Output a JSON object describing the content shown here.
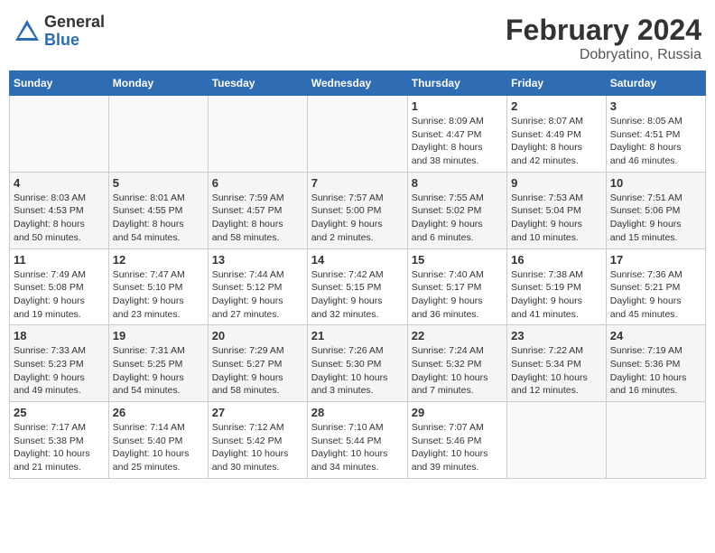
{
  "header": {
    "logo_general": "General",
    "logo_blue": "Blue",
    "month": "February 2024",
    "location": "Dobryatino, Russia"
  },
  "days_of_week": [
    "Sunday",
    "Monday",
    "Tuesday",
    "Wednesday",
    "Thursday",
    "Friday",
    "Saturday"
  ],
  "weeks": [
    [
      {
        "day": "",
        "info": ""
      },
      {
        "day": "",
        "info": ""
      },
      {
        "day": "",
        "info": ""
      },
      {
        "day": "",
        "info": ""
      },
      {
        "day": "1",
        "info": "Sunrise: 8:09 AM\nSunset: 4:47 PM\nDaylight: 8 hours\nand 38 minutes."
      },
      {
        "day": "2",
        "info": "Sunrise: 8:07 AM\nSunset: 4:49 PM\nDaylight: 8 hours\nand 42 minutes."
      },
      {
        "day": "3",
        "info": "Sunrise: 8:05 AM\nSunset: 4:51 PM\nDaylight: 8 hours\nand 46 minutes."
      }
    ],
    [
      {
        "day": "4",
        "info": "Sunrise: 8:03 AM\nSunset: 4:53 PM\nDaylight: 8 hours\nand 50 minutes."
      },
      {
        "day": "5",
        "info": "Sunrise: 8:01 AM\nSunset: 4:55 PM\nDaylight: 8 hours\nand 54 minutes."
      },
      {
        "day": "6",
        "info": "Sunrise: 7:59 AM\nSunset: 4:57 PM\nDaylight: 8 hours\nand 58 minutes."
      },
      {
        "day": "7",
        "info": "Sunrise: 7:57 AM\nSunset: 5:00 PM\nDaylight: 9 hours\nand 2 minutes."
      },
      {
        "day": "8",
        "info": "Sunrise: 7:55 AM\nSunset: 5:02 PM\nDaylight: 9 hours\nand 6 minutes."
      },
      {
        "day": "9",
        "info": "Sunrise: 7:53 AM\nSunset: 5:04 PM\nDaylight: 9 hours\nand 10 minutes."
      },
      {
        "day": "10",
        "info": "Sunrise: 7:51 AM\nSunset: 5:06 PM\nDaylight: 9 hours\nand 15 minutes."
      }
    ],
    [
      {
        "day": "11",
        "info": "Sunrise: 7:49 AM\nSunset: 5:08 PM\nDaylight: 9 hours\nand 19 minutes."
      },
      {
        "day": "12",
        "info": "Sunrise: 7:47 AM\nSunset: 5:10 PM\nDaylight: 9 hours\nand 23 minutes."
      },
      {
        "day": "13",
        "info": "Sunrise: 7:44 AM\nSunset: 5:12 PM\nDaylight: 9 hours\nand 27 minutes."
      },
      {
        "day": "14",
        "info": "Sunrise: 7:42 AM\nSunset: 5:15 PM\nDaylight: 9 hours\nand 32 minutes."
      },
      {
        "day": "15",
        "info": "Sunrise: 7:40 AM\nSunset: 5:17 PM\nDaylight: 9 hours\nand 36 minutes."
      },
      {
        "day": "16",
        "info": "Sunrise: 7:38 AM\nSunset: 5:19 PM\nDaylight: 9 hours\nand 41 minutes."
      },
      {
        "day": "17",
        "info": "Sunrise: 7:36 AM\nSunset: 5:21 PM\nDaylight: 9 hours\nand 45 minutes."
      }
    ],
    [
      {
        "day": "18",
        "info": "Sunrise: 7:33 AM\nSunset: 5:23 PM\nDaylight: 9 hours\nand 49 minutes."
      },
      {
        "day": "19",
        "info": "Sunrise: 7:31 AM\nSunset: 5:25 PM\nDaylight: 9 hours\nand 54 minutes."
      },
      {
        "day": "20",
        "info": "Sunrise: 7:29 AM\nSunset: 5:27 PM\nDaylight: 9 hours\nand 58 minutes."
      },
      {
        "day": "21",
        "info": "Sunrise: 7:26 AM\nSunset: 5:30 PM\nDaylight: 10 hours\nand 3 minutes."
      },
      {
        "day": "22",
        "info": "Sunrise: 7:24 AM\nSunset: 5:32 PM\nDaylight: 10 hours\nand 7 minutes."
      },
      {
        "day": "23",
        "info": "Sunrise: 7:22 AM\nSunset: 5:34 PM\nDaylight: 10 hours\nand 12 minutes."
      },
      {
        "day": "24",
        "info": "Sunrise: 7:19 AM\nSunset: 5:36 PM\nDaylight: 10 hours\nand 16 minutes."
      }
    ],
    [
      {
        "day": "25",
        "info": "Sunrise: 7:17 AM\nSunset: 5:38 PM\nDaylight: 10 hours\nand 21 minutes."
      },
      {
        "day": "26",
        "info": "Sunrise: 7:14 AM\nSunset: 5:40 PM\nDaylight: 10 hours\nand 25 minutes."
      },
      {
        "day": "27",
        "info": "Sunrise: 7:12 AM\nSunset: 5:42 PM\nDaylight: 10 hours\nand 30 minutes."
      },
      {
        "day": "28",
        "info": "Sunrise: 7:10 AM\nSunset: 5:44 PM\nDaylight: 10 hours\nand 34 minutes."
      },
      {
        "day": "29",
        "info": "Sunrise: 7:07 AM\nSunset: 5:46 PM\nDaylight: 10 hours\nand 39 minutes."
      },
      {
        "day": "",
        "info": ""
      },
      {
        "day": "",
        "info": ""
      }
    ]
  ]
}
